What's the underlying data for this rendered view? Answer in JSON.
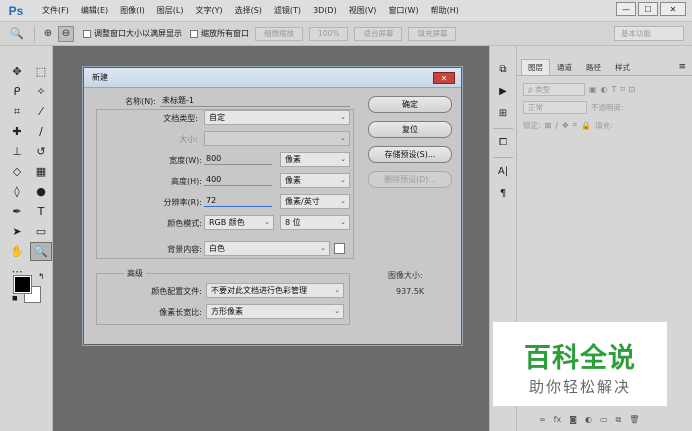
{
  "app": {
    "logo": "Ps"
  },
  "menu": [
    "文件(F)",
    "编辑(E)",
    "图像(I)",
    "图层(L)",
    "文字(Y)",
    "选择(S)",
    "滤镜(T)",
    "3D(D)",
    "视图(V)",
    "窗口(W)",
    "帮助(H)"
  ],
  "window_controls": {
    "minimize": "—",
    "maximize": "☐",
    "close": "✕"
  },
  "options_bar": {
    "check1": "调整窗口大小以满屏显示",
    "check2": "缩放所有窗口",
    "btn_scrubby": "细微缩放",
    "btn_zoom": "100%",
    "btn_fit": "适合屏幕",
    "btn_fill": "填充屏幕",
    "workspace": "基本功能"
  },
  "layers_panel": {
    "tabs": [
      "图层",
      "通道",
      "路径",
      "样式"
    ],
    "kind": "ρ 类型",
    "blend": "正常",
    "opacity": "不透明度:",
    "lock": "锁定:",
    "fill": "填充:"
  },
  "dialog": {
    "title": "新建",
    "name_label": "名称(N):",
    "name_value": "未标题-1",
    "preset_label": "文档类型:",
    "preset_value": "自定",
    "size_label": "大小:",
    "width_label": "宽度(W):",
    "width_value": "800",
    "width_unit": "像素",
    "height_label": "高度(H):",
    "height_value": "400",
    "height_unit": "像素",
    "res_label": "分辨率(R):",
    "res_value": "72",
    "res_unit": "像素/英寸",
    "mode_label": "颜色模式:",
    "mode_value": "RGB 颜色",
    "depth_value": "8 位",
    "bg_label": "背景内容:",
    "bg_value": "白色",
    "advanced_title": "高级",
    "profile_label": "颜色配置文件:",
    "profile_value": "不要对此文档进行色彩管理",
    "pixel_label": "像素长宽比:",
    "pixel_value": "方形像素",
    "ok": "确定",
    "reset": "复位",
    "save_preset": "存储预设(S)...",
    "delete_preset": "删除预设(D)...",
    "image_size_label": "图像大小:",
    "image_size_value": "937.5K"
  },
  "watermark": {
    "main": "百科全说",
    "sub": "助你轻松解决"
  }
}
